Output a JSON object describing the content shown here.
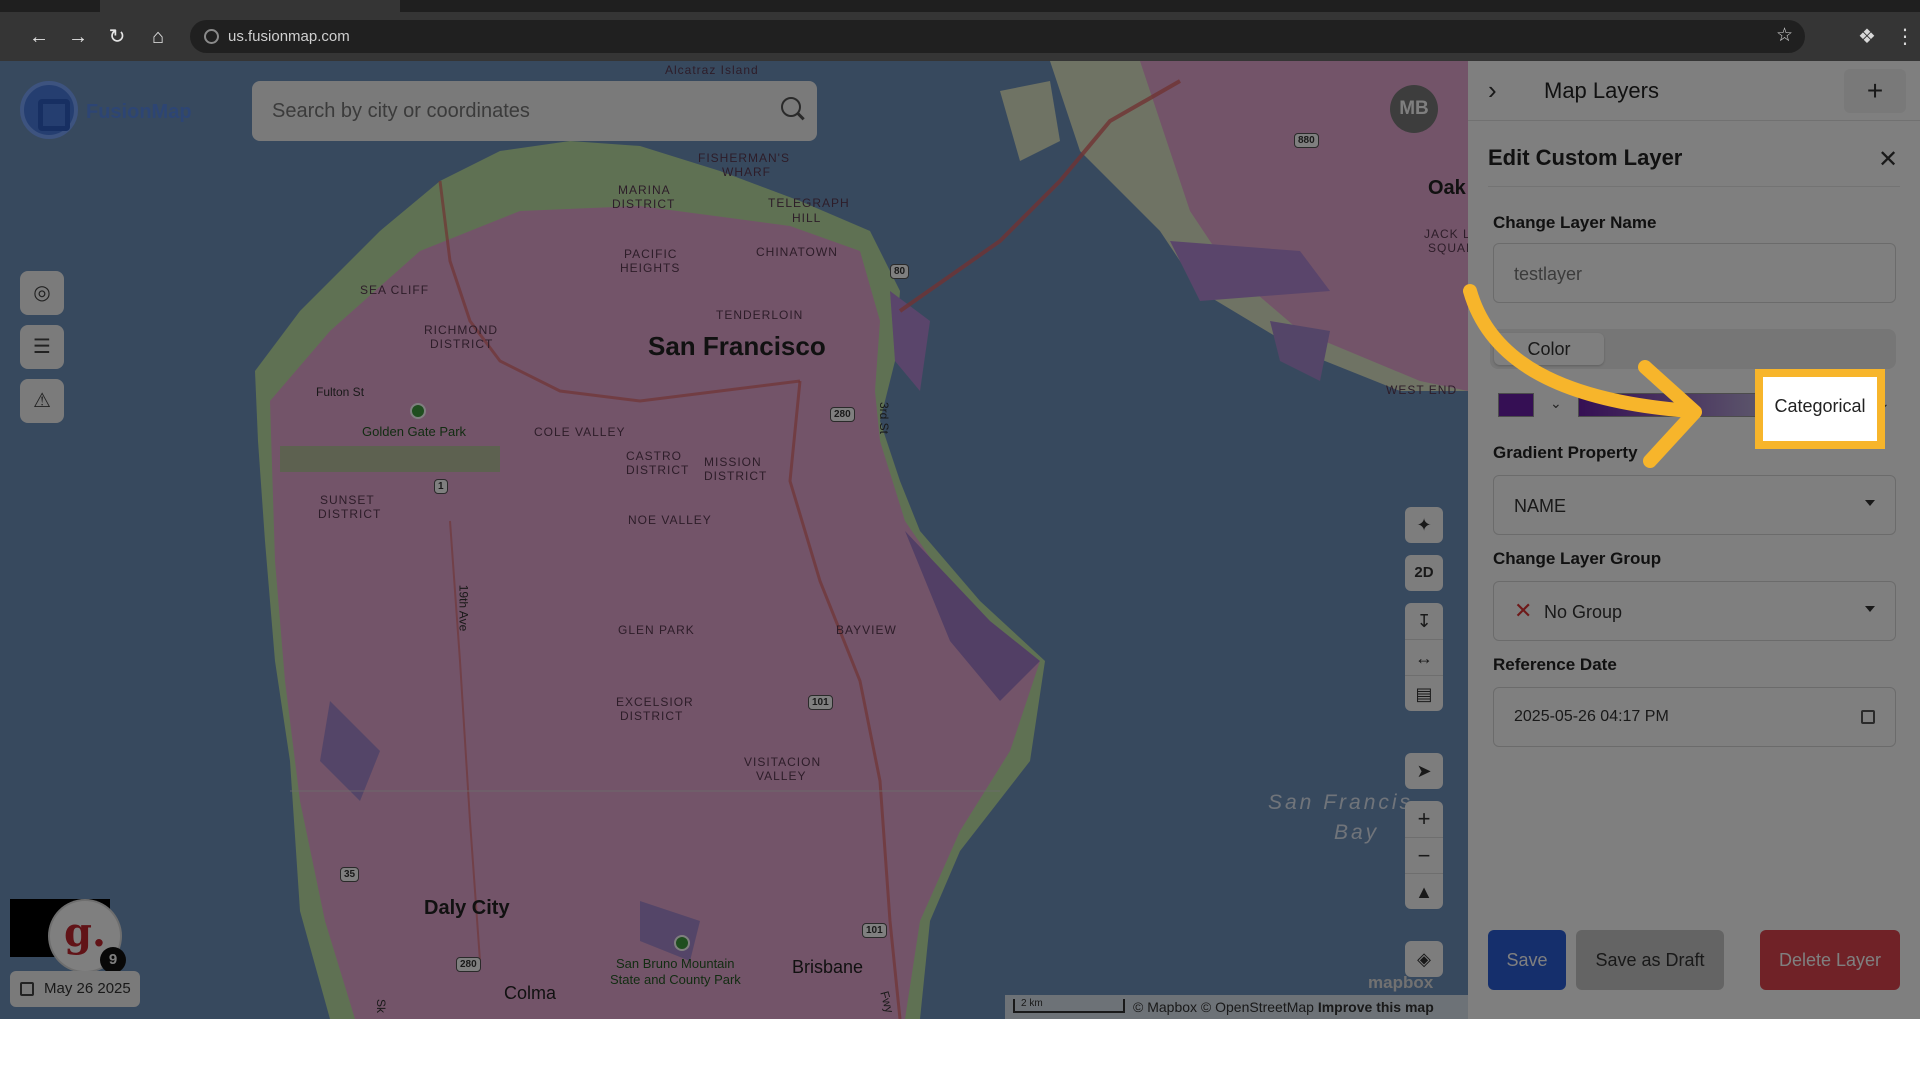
{
  "browser": {
    "url": "us.fusionmap.com"
  },
  "app": {
    "brand": "FusionMap",
    "search_placeholder": "Search by city or coordinates",
    "user_initials": "MB",
    "date_chip": "May 26 2025",
    "notification_count": "9",
    "badge_letter": "g."
  },
  "map": {
    "city_labels": [
      {
        "text": "San Francisco",
        "name": "map-label-san-francisco"
      },
      {
        "text": "Daly City",
        "name": "map-label-daly-city"
      },
      {
        "text": "Oak",
        "name": "map-label-oak"
      },
      {
        "text": "Brisbane",
        "name": "map-label-brisbane"
      },
      {
        "text": "Colma",
        "name": "map-label-colma"
      }
    ],
    "district_labels": [
      "Alcatraz Island",
      "FISHERMAN'S",
      "WHARF",
      "MARINA",
      "DISTRICT",
      "TELEGRAPH",
      "HILL",
      "PACIFIC",
      "HEIGHTS",
      "CHINATOWN",
      "SEA CLIFF",
      "TENDERLOIN",
      "RICHMOND",
      "DISTRICT",
      "Fulton St",
      "Golden Gate Park",
      "COLE VALLEY",
      "CASTRO",
      "DISTRICT",
      "MISSION",
      "DISTRICT",
      "SUNSET",
      "DISTRICT",
      "NOE VALLEY",
      "GLEN PARK",
      "BAYVIEW",
      "EXCELSIOR",
      "DISTRICT",
      "VISITACION",
      "VALLEY",
      "San Bruno Mountain",
      "State and County Park",
      "San Francis",
      "Bay",
      "JACK LO",
      "SQUAR",
      "WEST END",
      "19th Ave",
      "3rd St",
      "Sk",
      "Fwy"
    ],
    "shields": [
      "80",
      "280",
      "1",
      "101",
      "35",
      "280",
      "101",
      "880"
    ],
    "attribution": "© Mapbox © OpenStreetMap",
    "improve": "Improve this map",
    "scale": "2 km",
    "mapbox_logo": "mapbox",
    "controls": {
      "view_mode": "2D"
    }
  },
  "panel": {
    "header_title": "Map Layers",
    "section_title": "Edit Custom Layer",
    "layer_name_label": "Change Layer Name",
    "layer_name_value": "testlayer",
    "style_options": [
      "Color",
      "Categorical"
    ],
    "gradient_label": "Gradient Property",
    "gradient_value": "NAME",
    "group_label": "Change Layer Group",
    "group_value": "No Group",
    "ref_date_label": "Reference Date",
    "ref_date_value": "2025-05-26 04:17 PM",
    "save": "Save",
    "save_draft": "Save as Draft",
    "delete": "Delete Layer"
  },
  "colors": {
    "accent_highlight": "#f7b52b",
    "save_blue": "#2b5fd9",
    "delete_red": "#e0454f",
    "draft_gray": "#c9c9c9",
    "layer_purple": "#6b1fa8",
    "layer_fill": "#e7a8d2"
  },
  "icons": [
    "back-icon",
    "forward-icon",
    "reload-icon",
    "home-icon",
    "star-icon",
    "extension-icon",
    "menu-icon",
    "search-icon",
    "screenshot-icon",
    "list-icon",
    "warning-icon",
    "ai-sparkle-icon",
    "download-icon",
    "split-icon",
    "ruler-icon",
    "locate-icon",
    "plus-icon",
    "minus-icon",
    "compass-icon",
    "layers-icon",
    "chevron-right-icon",
    "close-icon",
    "calendar-icon"
  ]
}
